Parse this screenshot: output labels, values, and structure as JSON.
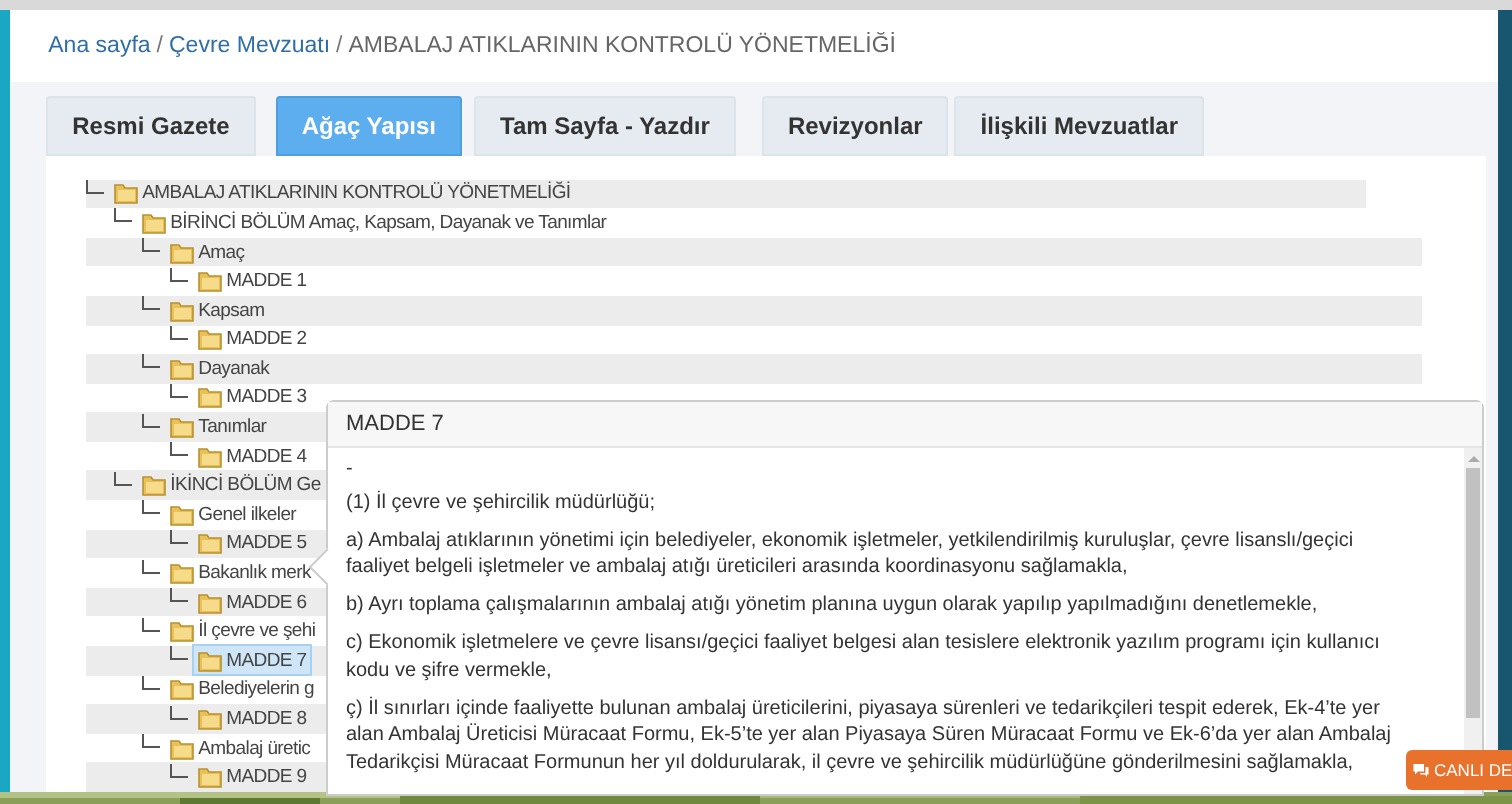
{
  "breadcrumb": [
    {
      "label": "Ana sayfa",
      "link": true
    },
    {
      "separator": "/"
    },
    {
      "label": "Çevre Mevzuatı",
      "link": true
    },
    {
      "separator": "/"
    },
    {
      "label": "AMBALAJ ATIKLARININ KONTROLÜ YÖNETMELİĞİ",
      "link": false
    }
  ],
  "tabs": [
    {
      "label": "Resmi Gazete",
      "selected": false
    },
    {
      "label": "Ağaç Yapısı",
      "selected": true
    },
    {
      "label": "Tam Sayfa - Yazdır",
      "selected": false
    },
    {
      "label": "Revizyonlar",
      "selected": false
    },
    {
      "label": "İlişkili Mevzuatlar",
      "selected": false
    }
  ],
  "tree": [
    {
      "label": "AMBALAJ ATIKLARININ KONTROLÜ YÖNETMELİĞİ",
      "selected": false,
      "children": [
        {
          "label": "BİRİNCİ BÖLÜM Amaç, Kapsam, Dayanak ve Tanımlar",
          "selected": false,
          "children": [
            {
              "label": "Amaç",
              "selected": false,
              "children": [
                {
                  "label": "MADDE 1",
                  "selected": false
                }
              ]
            },
            {
              "label": "Kapsam",
              "selected": false,
              "children": [
                {
                  "label": "MADDE 2",
                  "selected": false
                }
              ]
            },
            {
              "label": "Dayanak",
              "selected": false,
              "children": [
                {
                  "label": "MADDE 3",
                  "selected": false
                }
              ]
            },
            {
              "label": "Tanımlar",
              "selected": false,
              "children": [
                {
                  "label": "MADDE 4",
                  "selected": false
                }
              ]
            }
          ]
        },
        {
          "label": "İKİNCİ BÖLÜM Ge",
          "selected": false,
          "children": [
            {
              "label": "Genel ilkeler",
              "selected": false,
              "children": [
                {
                  "label": "MADDE 5",
                  "selected": false
                }
              ]
            },
            {
              "label": "Bakanlık merk",
              "selected": false,
              "children": [
                {
                  "label": "MADDE 6",
                  "selected": false
                }
              ]
            },
            {
              "label": "İl çevre ve şehi",
              "selected": false,
              "children": [
                {
                  "label": "MADDE 7",
                  "selected": true
                }
              ]
            },
            {
              "label": "Belediyelerin g",
              "selected": false,
              "children": [
                {
                  "label": "MADDE 8",
                  "selected": false
                }
              ]
            },
            {
              "label": "Ambalaj üretic",
              "selected": false,
              "children": [
                {
                  "label": "MADDE 9",
                  "selected": false
                }
              ]
            }
          ]
        }
      ]
    }
  ],
  "popup": {
    "title": "MADDE 7",
    "paragraphs": [
      "-",
      "(1) İl çevre ve şehircilik müdürlüğü;",
      "a) Ambalaj atıklarının yönetimi için belediyeler, ekonomik işletmeler, yetkilendirilmiş kuruluşlar, çevre lisanslı/geçici faaliyet belgeli işletmeler ve ambalaj atığı üreticileri arasında koordinasyonu sağlamakla,",
      "b) Ayrı toplama çalışmalarının ambalaj atığı yönetim planına uygun olarak yapılıp yapılmadığını denetlemekle,",
      "c) Ekonomik işletmelere ve çevre lisansı/geçici faaliyet belgesi alan tesislere elektronik yazılım programı için kullanıcı kodu ve şifre vermekle,",
      "ç) İl sınırları içinde faaliyette bulunan ambalaj üreticilerini, piyasaya sürenleri ve tedarikçileri tespit ederek, Ek-4’te yer alan Ambalaj Üreticisi Müracaat Formu, Ek-5’te yer alan Piyasaya Süren Müracaat Formu ve Ek-6’da yer alan Ambalaj Tedarikçisi Müracaat Formunun her yıl doldurularak, il çevre ve şehircilik müdürlüğüne gönderilmesini sağlamakla,"
    ]
  },
  "chat_button": {
    "label": "CANLI DE"
  }
}
